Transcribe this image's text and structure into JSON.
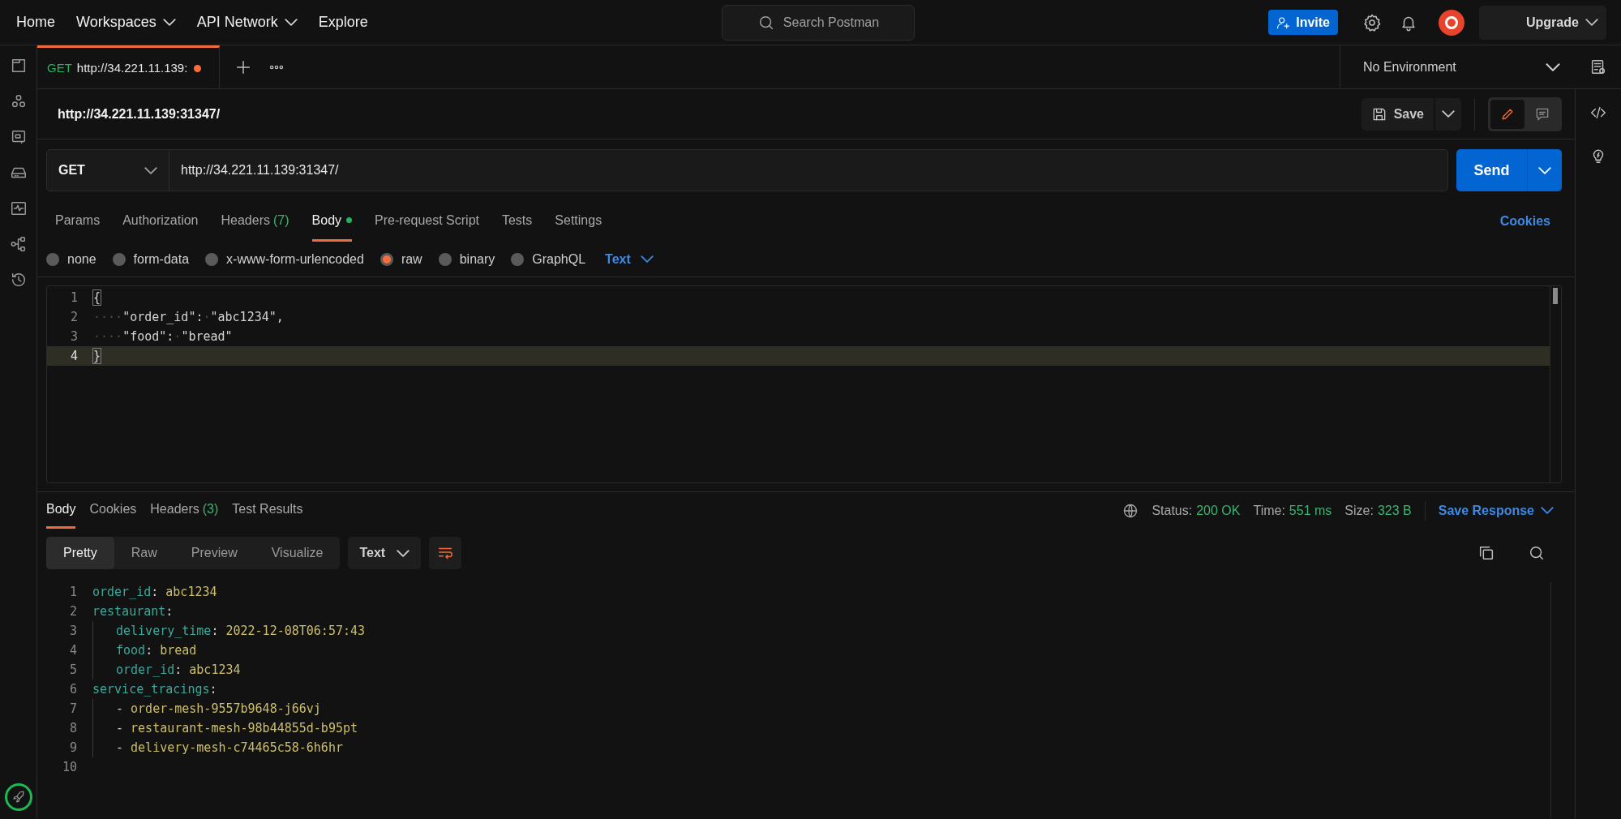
{
  "nav": [
    {
      "label": "Home",
      "dropdown": false
    },
    {
      "label": "Workspaces",
      "dropdown": true
    },
    {
      "label": "API Network",
      "dropdown": true
    },
    {
      "label": "Explore",
      "dropdown": false
    }
  ],
  "search": {
    "placeholder": "Search Postman"
  },
  "invite": "Invite",
  "upgrade": "Upgrade",
  "request_tab": {
    "method": "GET",
    "title": "http://34.221.11.139:",
    "unsaved": true,
    "selected": true
  },
  "environment": "No Environment",
  "request_name": "http://34.221.11.139:31347/",
  "save": "Save",
  "modes": [
    {
      "kind": "edit",
      "selected": true
    },
    {
      "kind": "comment",
      "selected": false
    }
  ],
  "method": "GET",
  "url": "http://34.221.11.139:31347/",
  "send": "Send",
  "request_tabs": [
    {
      "label": "Params",
      "selected": false
    },
    {
      "label": "Authorization",
      "selected": false
    },
    {
      "label": "Headers",
      "count": "(7)",
      "selected": false
    },
    {
      "label": "Body",
      "has_content": true,
      "selected": true
    },
    {
      "label": "Pre-request Script",
      "selected": false
    },
    {
      "label": "Tests",
      "selected": false
    },
    {
      "label": "Settings",
      "selected": false
    }
  ],
  "cookies_link": "Cookies",
  "body_types": [
    {
      "label": "none",
      "selected": false
    },
    {
      "label": "form-data",
      "selected": false
    },
    {
      "label": "x-www-form-urlencoded",
      "selected": false
    },
    {
      "label": "raw",
      "selected": true
    },
    {
      "label": "binary",
      "selected": false
    },
    {
      "label": "GraphQL",
      "selected": false
    }
  ],
  "raw_format": "Text",
  "request_body": [
    {
      "number": "1",
      "highlighted": false,
      "tokens": [
        {
          "kind": "bracket",
          "text": "{"
        }
      ]
    },
    {
      "number": "2",
      "highlighted": false,
      "tokens": [
        {
          "kind": "ws",
          "text": "····"
        },
        {
          "kind": "text",
          "text": "\"order_id\":"
        },
        {
          "kind": "ws",
          "text": "·"
        },
        {
          "kind": "text",
          "text": "\"abc1234\","
        }
      ]
    },
    {
      "number": "3",
      "highlighted": false,
      "tokens": [
        {
          "kind": "ws",
          "text": "····"
        },
        {
          "kind": "text",
          "text": "\"food\":"
        },
        {
          "kind": "ws",
          "text": "·"
        },
        {
          "kind": "text",
          "text": "\"bread\""
        }
      ]
    },
    {
      "number": "4",
      "highlighted": true,
      "tokens": [
        {
          "kind": "bracket",
          "text": "}"
        }
      ]
    }
  ],
  "response_tabs": [
    {
      "label": "Body",
      "selected": true
    },
    {
      "label": "Cookies",
      "selected": false
    },
    {
      "label": "Headers",
      "count": "(3)",
      "selected": false
    },
    {
      "label": "Test Results",
      "selected": false
    }
  ],
  "response_stats": [
    {
      "label": "Status:",
      "value": "200 OK"
    },
    {
      "label": "Time:",
      "value": "551 ms"
    },
    {
      "label": "Size:",
      "value": "323 B"
    }
  ],
  "save_response": "Save Response",
  "view_modes": [
    {
      "label": "Pretty",
      "selected": true
    },
    {
      "label": "Raw",
      "selected": false
    },
    {
      "label": "Preview",
      "selected": false
    },
    {
      "label": "Visualize",
      "selected": false
    }
  ],
  "response_format": "Text",
  "response_body": [
    {
      "number": "1",
      "tokens": [
        {
          "kind": "key",
          "text": "order_id"
        },
        {
          "kind": "punct",
          "text": ":"
        },
        {
          "kind": "value",
          "text": "abc1234"
        }
      ]
    },
    {
      "number": "2",
      "tokens": [
        {
          "kind": "key",
          "text": "restaurant"
        },
        {
          "kind": "punct",
          "text": ":"
        }
      ],
      "children": [
        {
          "number": "3",
          "tokens": [
            {
              "kind": "key",
              "text": "delivery_time"
            },
            {
              "kind": "punct",
              "text": ":"
            },
            {
              "kind": "value",
              "text": "2022-12-08T06:57:43"
            }
          ]
        },
        {
          "number": "4",
          "tokens": [
            {
              "kind": "key",
              "text": "food"
            },
            {
              "kind": "punct",
              "text": ":"
            },
            {
              "kind": "value",
              "text": "bread"
            }
          ]
        },
        {
          "number": "5",
          "tokens": [
            {
              "kind": "key",
              "text": "order_id"
            },
            {
              "kind": "punct",
              "text": ":"
            },
            {
              "kind": "value",
              "text": "abc1234"
            }
          ]
        }
      ]
    },
    {
      "number": "6",
      "tokens": [
        {
          "kind": "key",
          "text": "service_tracings"
        },
        {
          "kind": "punct",
          "text": ":"
        }
      ],
      "children": [
        {
          "number": "7",
          "tokens": [
            {
              "kind": "punct",
              "text": "-"
            },
            {
              "kind": "value",
              "text": "order-mesh-9557b9648-j66vj"
            }
          ]
        },
        {
          "number": "8",
          "tokens": [
            {
              "kind": "punct",
              "text": "-"
            },
            {
              "kind": "value",
              "text": "restaurant-mesh-98b44855d-b95pt"
            }
          ]
        },
        {
          "number": "9",
          "tokens": [
            {
              "kind": "punct",
              "text": "-"
            },
            {
              "kind": "value",
              "text": "delivery-mesh-c74465c58-6h6hr"
            }
          ]
        }
      ]
    },
    {
      "number": "10"
    }
  ]
}
